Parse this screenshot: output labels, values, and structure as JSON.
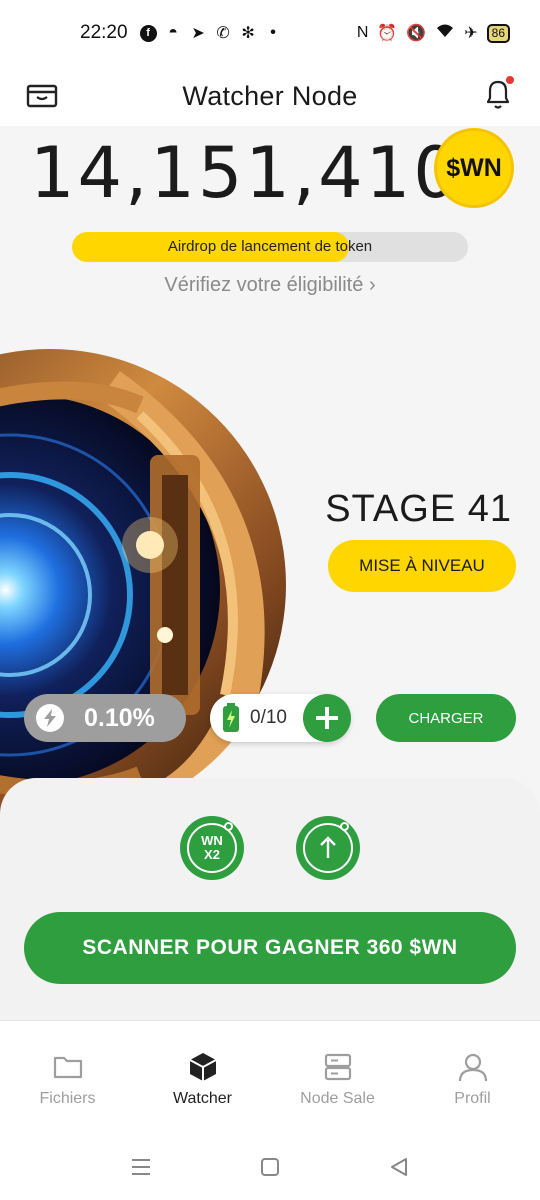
{
  "status_bar": {
    "time": "22:20",
    "battery_level": "86",
    "left_icons": [
      "facebook-icon",
      "discord-icon",
      "telegram-icon",
      "whatsapp-icon",
      "sync-icon",
      "dot-icon"
    ],
    "right_icons": [
      "nfc-icon",
      "alarm-icon",
      "vibrate-off-icon",
      "wifi-icon",
      "airplane-icon",
      "battery-icon"
    ]
  },
  "header": {
    "title": "Watcher Node"
  },
  "balance": {
    "amount": "14,151,410",
    "token_badge": "$WN"
  },
  "airdrop": {
    "label": "Airdrop de lancement de token",
    "progress_fraction": 0.7
  },
  "eligibility_link": "Vérifiez votre éligibilité",
  "stage": {
    "label": "STAGE 41",
    "upgrade_label": "MISE À NIVEAU"
  },
  "stats": {
    "boost_value": "0.10%",
    "battery_count": "0/10",
    "charge_label": "CHARGER"
  },
  "actions": {
    "multiplier_label_top": "WN",
    "multiplier_label_bottom": "X2",
    "scan_label": "SCANNER POUR GAGNER 360 $WN"
  },
  "bottom_nav": {
    "items": [
      {
        "label": "Fichiers",
        "icon": "folder-icon",
        "active": false
      },
      {
        "label": "Watcher",
        "icon": "cube-icon",
        "active": true
      },
      {
        "label": "Node Sale",
        "icon": "server-icon",
        "active": false
      },
      {
        "label": "Profil",
        "icon": "user-icon",
        "active": false
      }
    ]
  },
  "colors": {
    "accent_yellow": "#ffd600",
    "accent_green": "#2e9e3f",
    "text_dark": "#1b1b1b",
    "text_muted": "#8a8a8a"
  }
}
